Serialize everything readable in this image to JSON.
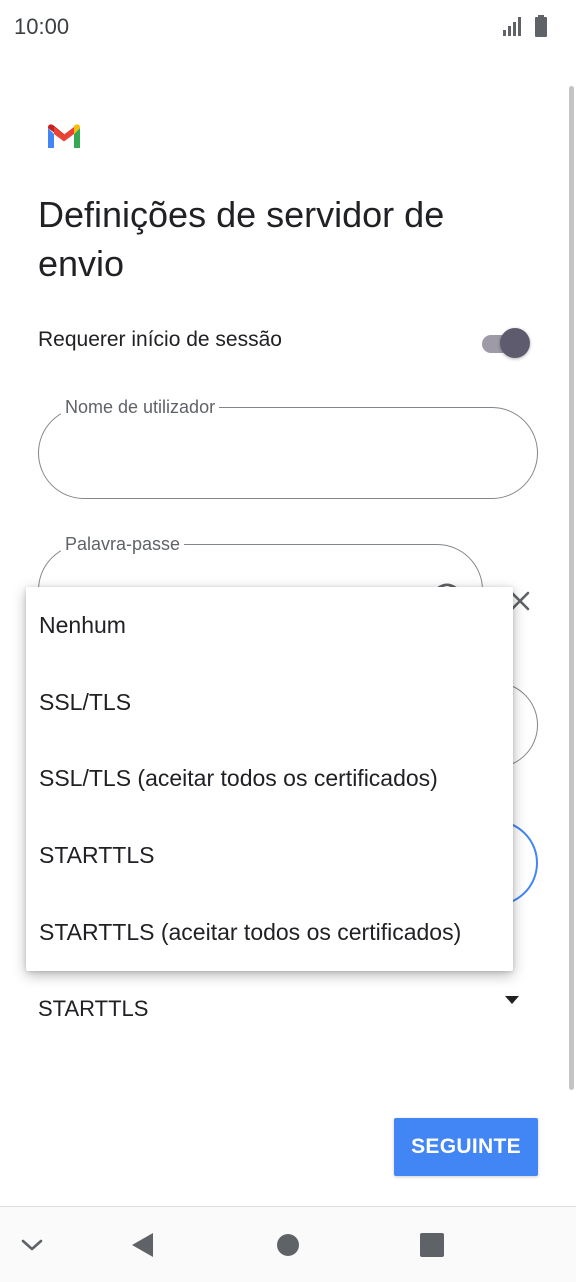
{
  "status_bar": {
    "time": "10:00"
  },
  "colors": {
    "accent": "#4285f4",
    "toggle_thumb": "#5e5b6e",
    "text": "#202124"
  },
  "icons": [
    "gmail-logo",
    "signal-icon",
    "battery-icon",
    "eye-icon",
    "close-icon",
    "dropdown-arrow-icon",
    "nav-collapse-icon",
    "nav-back-icon",
    "nav-home-icon",
    "nav-recents-icon"
  ],
  "page": {
    "title": "Definições de servidor de envio"
  },
  "require_signin": {
    "label": "Requerer início de sessão",
    "enabled": true
  },
  "username_field": {
    "label": "Nome de utilizador",
    "value": ""
  },
  "password_field": {
    "label": "Palavra-passe",
    "value": ""
  },
  "security_type": {
    "selected": "STARTTLS",
    "options": [
      "Nenhum",
      "SSL/TLS",
      "SSL/TLS (aceitar todos os certificados)",
      "STARTTLS",
      "STARTTLS (aceitar todos os certificados)"
    ]
  },
  "actions": {
    "next_label": "SEGUINTE"
  }
}
